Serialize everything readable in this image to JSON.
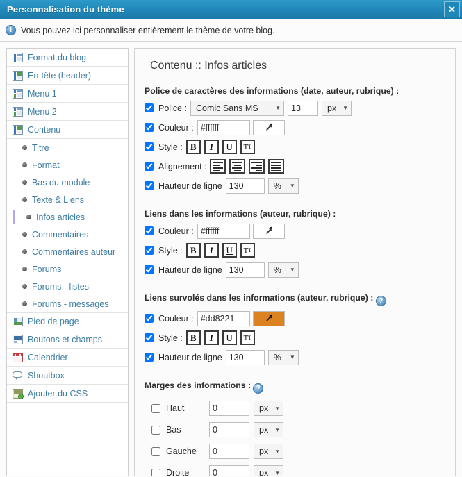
{
  "window": {
    "title": "Personnalisation du thème",
    "close_label": "✕",
    "info_text": "Vous pouvez ici personnaliser entièrement le thème de votre blog.",
    "info_icon": "info-icon"
  },
  "sidebar": {
    "items": [
      {
        "label": "Format du blog",
        "icon": "page-layout-blue-icon",
        "type": "top"
      },
      {
        "label": "En-tête (header)",
        "icon": "page-layout-green-icon",
        "type": "top"
      },
      {
        "label": "Menu 1",
        "icon": "page-layout-menu-icon",
        "type": "top"
      },
      {
        "label": "Menu 2",
        "icon": "page-layout-menu-icon",
        "type": "top"
      },
      {
        "label": "Contenu",
        "icon": "page-layout-content-icon",
        "type": "top"
      },
      {
        "label": "Titre",
        "icon": "bullet-icon",
        "type": "sub"
      },
      {
        "label": "Format",
        "icon": "bullet-icon",
        "type": "sub"
      },
      {
        "label": "Bas du module",
        "icon": "bullet-icon",
        "type": "sub"
      },
      {
        "label": "Texte & Liens",
        "icon": "bullet-icon",
        "type": "sub"
      },
      {
        "label": "Infos articles",
        "icon": "bullet-icon",
        "type": "sub",
        "selected": true
      },
      {
        "label": "Commentaires",
        "icon": "bullet-icon",
        "type": "sub"
      },
      {
        "label": "Commentaires auteur",
        "icon": "bullet-icon",
        "type": "sub"
      },
      {
        "label": "Forums",
        "icon": "bullet-icon",
        "type": "sub"
      },
      {
        "label": "Forums - listes",
        "icon": "bullet-icon",
        "type": "sub"
      },
      {
        "label": "Forums - messages",
        "icon": "bullet-icon",
        "type": "sub"
      },
      {
        "label": "Pied de page",
        "icon": "footer-icon",
        "type": "top"
      },
      {
        "label": "Boutons et champs",
        "icon": "button-icon",
        "type": "top"
      },
      {
        "label": "Calendrier",
        "icon": "calendar-icon",
        "type": "top"
      },
      {
        "label": "Shoutbox",
        "icon": "speech-bubble-icon",
        "type": "top"
      },
      {
        "label": "Ajouter du CSS",
        "icon": "css-add-icon",
        "type": "top"
      }
    ]
  },
  "main": {
    "panel_title": "Contenu :: Infos articles",
    "sections": [
      {
        "heading": "Police de caractères des informations (date, auteur, rubrique) :",
        "has_help": false,
        "rows": {
          "police_label": "Police :",
          "police_checked": true,
          "font_family": "Comic Sans MS",
          "font_size": "13",
          "font_unit": "px",
          "couleur_label": "Couleur :",
          "couleur_checked": true,
          "couleur_value": "#ffffff",
          "swatch_color": "#ffffff",
          "style_label": "Style :",
          "style_checked": true,
          "style_buttons": [
            "B",
            "I",
            "U",
            "TT"
          ],
          "alignement_label": "Alignement :",
          "alignement_checked": true,
          "hauteur_label": "Hauteur de ligne",
          "hauteur_checked": true,
          "hauteur_value": "130",
          "hauteur_unit": "%"
        }
      },
      {
        "heading": "Liens dans les informations (auteur, rubrique) :",
        "has_help": false,
        "rows": {
          "couleur_label": "Couleur :",
          "couleur_checked": true,
          "couleur_value": "#ffffff",
          "swatch_color": "#ffffff",
          "style_label": "Style :",
          "style_checked": true,
          "hauteur_label": "Hauteur de ligne",
          "hauteur_checked": true,
          "hauteur_value": "130",
          "hauteur_unit": "%"
        }
      },
      {
        "heading": "Liens survolés dans les informations (auteur, rubrique) :",
        "has_help": true,
        "help_icon": "help-icon",
        "rows": {
          "couleur_label": "Couleur :",
          "couleur_checked": true,
          "couleur_value": "#dd8221",
          "swatch_color": "#dd8221",
          "style_label": "Style :",
          "style_checked": true,
          "hauteur_label": "Hauteur de ligne",
          "hauteur_checked": true,
          "hauteur_value": "130",
          "hauteur_unit": "%"
        }
      }
    ],
    "margins": {
      "heading": "Marges des informations :",
      "has_help": true,
      "help_icon": "help-icon",
      "items": [
        {
          "label": "Haut",
          "checked": false,
          "value": "0",
          "unit": "px"
        },
        {
          "label": "Bas",
          "checked": false,
          "value": "0",
          "unit": "px"
        },
        {
          "label": "Gauche",
          "checked": false,
          "value": "0",
          "unit": "px"
        },
        {
          "label": "Droite",
          "checked": false,
          "value": "0",
          "unit": "px"
        }
      ]
    }
  },
  "colors": {
    "titlebar_start": "#2e9ac9",
    "titlebar_end": "#1c7ba8",
    "link_blue": "#3d7da3",
    "selected_bar": "#aeaaea",
    "accent_orange": "#dd8221"
  }
}
